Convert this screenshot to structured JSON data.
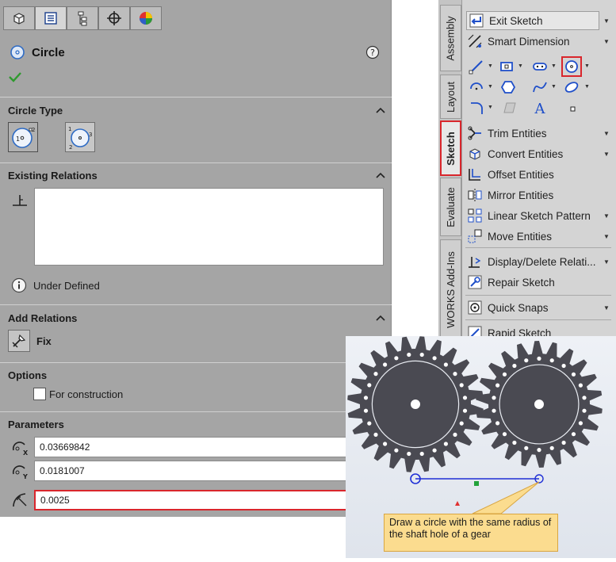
{
  "property_manager": {
    "tabs": [
      "feature-manager-icon",
      "property-manager-icon",
      "configuration-manager-icon",
      "dimxpert-icon",
      "display-manager-icon"
    ],
    "title": "Circle",
    "circle_type": {
      "title": "Circle Type",
      "options": [
        "center-circle-icon",
        "perimeter-circle-icon"
      ]
    },
    "existing_relations": {
      "title": "Existing Relations",
      "status": "Under Defined"
    },
    "add_relations": {
      "title": "Add Relations",
      "fix_label": "Fix"
    },
    "options": {
      "title": "Options",
      "for_construction_label": "For construction",
      "for_construction_checked": false
    },
    "parameters": {
      "title": "Parameters",
      "center_x": "0.03669842",
      "center_y": "0.0181007",
      "radius": "0.0025"
    }
  },
  "command_manager": {
    "tabs": [
      "Assembly",
      "Layout",
      "Sketch",
      "Evaluate",
      "WORKS Add-Ins"
    ],
    "active_tab": "Sketch",
    "commands": {
      "exit_sketch": "Exit Sketch",
      "smart_dimension": "Smart Dimension",
      "trim_entities": "Trim Entities",
      "convert_entities": "Convert Entities",
      "offset_entities": "Offset Entities",
      "mirror_entities": "Mirror Entities",
      "linear_sketch_pattern": "Linear Sketch Pattern",
      "move_entities": "Move Entities",
      "display_delete_relations": "Display/Delete Relati...",
      "repair_sketch": "Repair Sketch",
      "quick_snaps": "Quick Snaps",
      "rapid_sketch": "Rapid Sketch"
    }
  },
  "callout": {
    "text": "Draw a circle with the same radius of the shaft hole of a gear"
  },
  "colors": {
    "panel_bg": "#a5a5a5",
    "highlight_red": "#d9262c",
    "gear_fill": "#4a4a52",
    "sketch_blue": "#1f2fd6",
    "callout_bg": "#fbdc8f"
  }
}
